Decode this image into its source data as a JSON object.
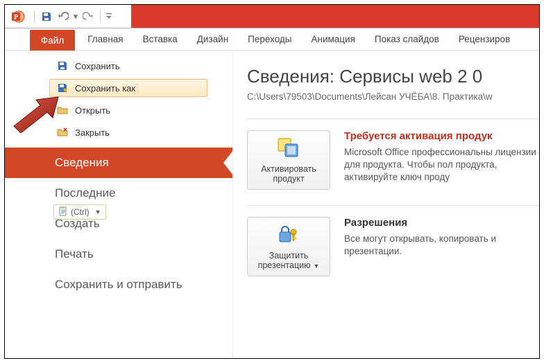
{
  "tabs": {
    "file": "Файл",
    "home": "Главная",
    "insert": "Вставка",
    "design": "Дизайн",
    "transitions": "Переходы",
    "animations": "Анимация",
    "slideshow": "Показ слайдов",
    "review": "Рецензиров"
  },
  "side": {
    "save": "Сохранить",
    "saveas": "Сохранить как",
    "open": "Открыть",
    "close": "Закрыть",
    "info": "Сведения",
    "recent": "Последние",
    "new": "Создать",
    "print": "Печать",
    "share": "Сохранить и отправить"
  },
  "paste": {
    "label": "(Ctrl)"
  },
  "info": {
    "title": "Сведения: Сервисы web 2 0",
    "path": "C:\\Users\\79503\\Documents\\Лейсан УЧЁБА\\8. Практика\\w"
  },
  "activate": {
    "btn": "Активировать продукт",
    "heading": "Требуется активация продук",
    "text": "Microsoft Office профессиональны лицензии для продукта. Чтобы пол продукта, активируйте ключ проду"
  },
  "permissions": {
    "btn": "Защитить презентацию",
    "heading": "Разрешения",
    "text": "Все могут открывать, копировать и презентации."
  }
}
